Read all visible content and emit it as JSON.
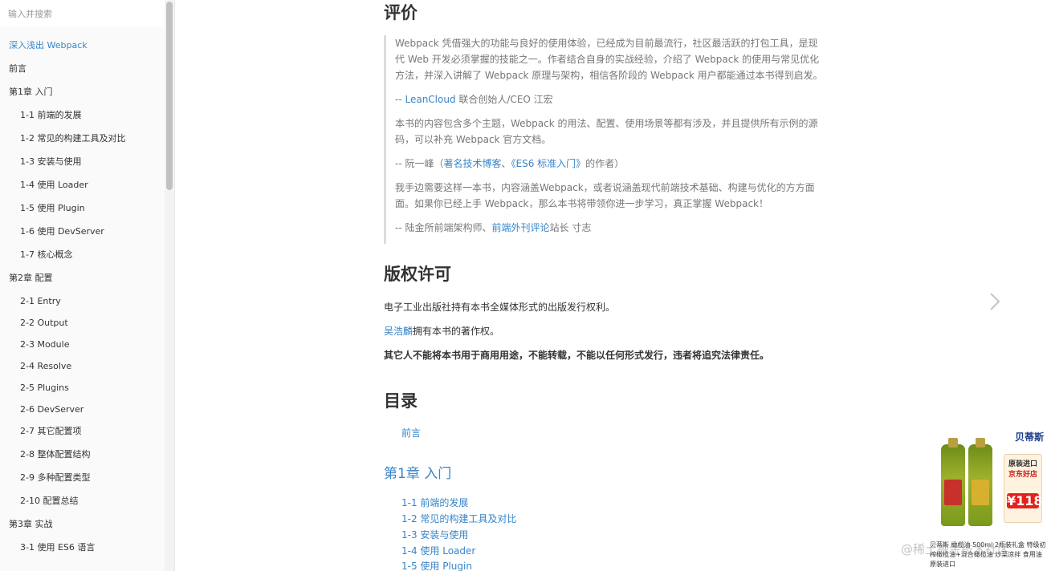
{
  "sidebar": {
    "search_placeholder": "输入并搜索",
    "items": [
      {
        "label": "深入浅出 Webpack"
      },
      {
        "label": "前言"
      },
      {
        "label": "第1章 入门"
      },
      {
        "label": "1-1 前端的发展"
      },
      {
        "label": "1-2 常见的构建工具及对比"
      },
      {
        "label": "1-3 安装与使用"
      },
      {
        "label": "1-4 使用 Loader"
      },
      {
        "label": "1-5 使用 Plugin"
      },
      {
        "label": "1-6 使用 DevServer"
      },
      {
        "label": "1-7 核心概念"
      },
      {
        "label": "第2章 配置"
      },
      {
        "label": "2-1 Entry"
      },
      {
        "label": "2-2 Output"
      },
      {
        "label": "2-3 Module"
      },
      {
        "label": "2-4 Resolve"
      },
      {
        "label": "2-5 Plugins"
      },
      {
        "label": "2-6 DevServer"
      },
      {
        "label": "2-7 其它配置项"
      },
      {
        "label": "2-8 整体配置结构"
      },
      {
        "label": "2-9 多种配置类型"
      },
      {
        "label": "2-10 配置总结"
      },
      {
        "label": "第3章 实战"
      },
      {
        "label": "3-1 使用 ES6 语言"
      }
    ]
  },
  "review": {
    "heading": "评价",
    "q1": "Webpack 凭借强大的功能与良好的使用体验，已经成为目前最流行，社区最活跃的打包工具，是现代 Web 开发必须掌握的技能之一。作者结合自身的实战经验，介绍了 Webpack 的使用与常见优化方法，并深入讲解了 Webpack 原理与架构，相信各阶段的 Webpack 用户都能通过本书得到启发。",
    "a1_prefix": "-- ",
    "a1_link": "LeanCloud",
    "a1_suffix": " 联合创始人/CEO 江宏",
    "q2": "本书的内容包含多个主题，Webpack 的用法、配置、使用场景等都有涉及，并且提供所有示例的源码，可以补充 Webpack 官方文档。",
    "a2_prefix": "-- 阮一峰（",
    "a2_link1": "著名技术博客",
    "a2_sep": "、",
    "a2_link2": "《ES6 标准入门》",
    "a2_suffix": "的作者）",
    "q3": "我手边需要这样一本书，内容涵盖Webpack，或者说涵盖现代前端技术基础、构建与优化的方方面面。如果你已经上手 Webpack，那么本书将带领你进一步学习，真正掌握 Webpack！",
    "a3_prefix": "-- 陆金所前端架构师、",
    "a3_link": "前端外刊评论",
    "a3_suffix": "站长 寸志"
  },
  "copyright": {
    "heading": "版权许可",
    "p1": "电子工业出版社持有本书全媒体形式的出版发行权利。",
    "p2_link": "吴浩麟",
    "p2_suffix": "拥有本书的著作权。",
    "p3": "其它人不能将本书用于商用用途，不能转载，不能以任何形式发行，违者将追究法律责任。"
  },
  "toc": {
    "heading": "目录",
    "preface": "前言",
    "chapter1": "第1章 入门",
    "items": [
      "1-1 前端的发展",
      "1-2 常见的构建工具及对比",
      "1-3 安装与使用",
      "1-4 使用 Loader",
      "1-5 使用 Plugin"
    ]
  },
  "ad": {
    "brand": "贝蒂斯",
    "promo_line1": "原装进口",
    "promo_line2": "京东好店",
    "price": "¥118",
    "text": "贝蒂斯 橄榄油 500ml 2瓶装礼盒 特级初榨橄榄油+混合橄榄油 炒菜凉拌 食用油 原装进口"
  },
  "watermark": "@稀土掘金技术社区",
  "colors": {
    "link": "#3884c8",
    "ad_price": "#e4211c"
  }
}
